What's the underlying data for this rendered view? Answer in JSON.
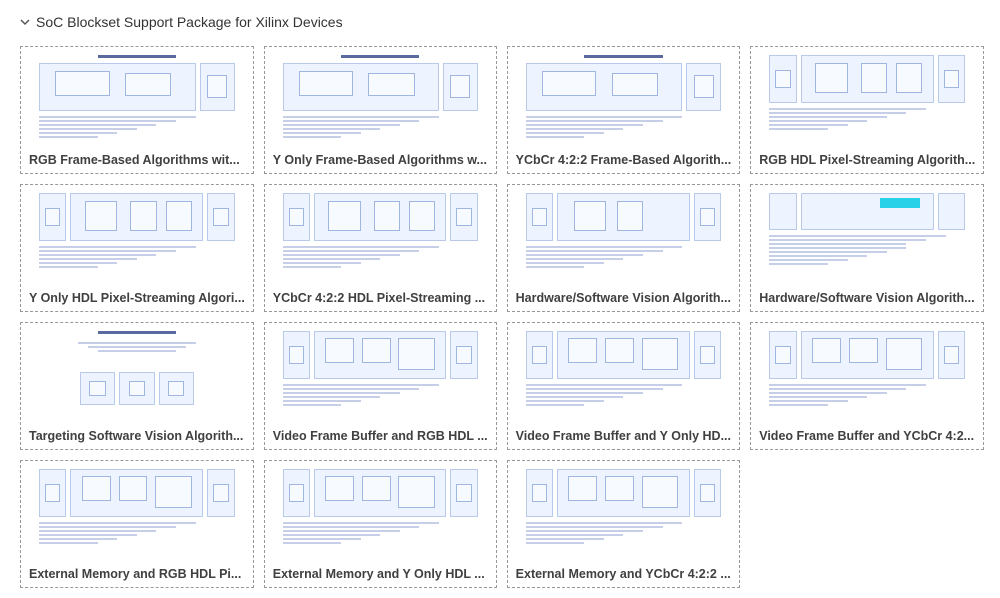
{
  "section": {
    "title": "SoC Blockset Support Package for Xilinx Devices"
  },
  "cards": [
    {
      "label": "RGB Frame-Based Algorithms wit...",
      "variant": 0
    },
    {
      "label": "Y Only Frame-Based Algorithms w...",
      "variant": 0
    },
    {
      "label": "YCbCr 4:2:2 Frame-Based Algorith...",
      "variant": 0
    },
    {
      "label": "RGB HDL Pixel-Streaming Algorith...",
      "variant": 1
    },
    {
      "label": "Y Only HDL Pixel-Streaming Algori...",
      "variant": 1
    },
    {
      "label": "YCbCr 4:2:2 HDL Pixel-Streaming ...",
      "variant": 1
    },
    {
      "label": "Hardware/Software Vision Algorith...",
      "variant": 2
    },
    {
      "label": "Hardware/Software Vision Algorith...",
      "variant": 3
    },
    {
      "label": "Targeting Software Vision Algorith...",
      "variant": 4
    },
    {
      "label": "Video Frame Buffer and RGB HDL ...",
      "variant": 5
    },
    {
      "label": "Video Frame Buffer and Y Only HD...",
      "variant": 5
    },
    {
      "label": "Video Frame Buffer and YCbCr 4:2...",
      "variant": 5
    },
    {
      "label": "External Memory and RGB HDL Pi...",
      "variant": 5
    },
    {
      "label": "External Memory and Y Only HDL ...",
      "variant": 5
    },
    {
      "label": "External Memory and YCbCr 4:2:2 ...",
      "variant": 5
    }
  ]
}
